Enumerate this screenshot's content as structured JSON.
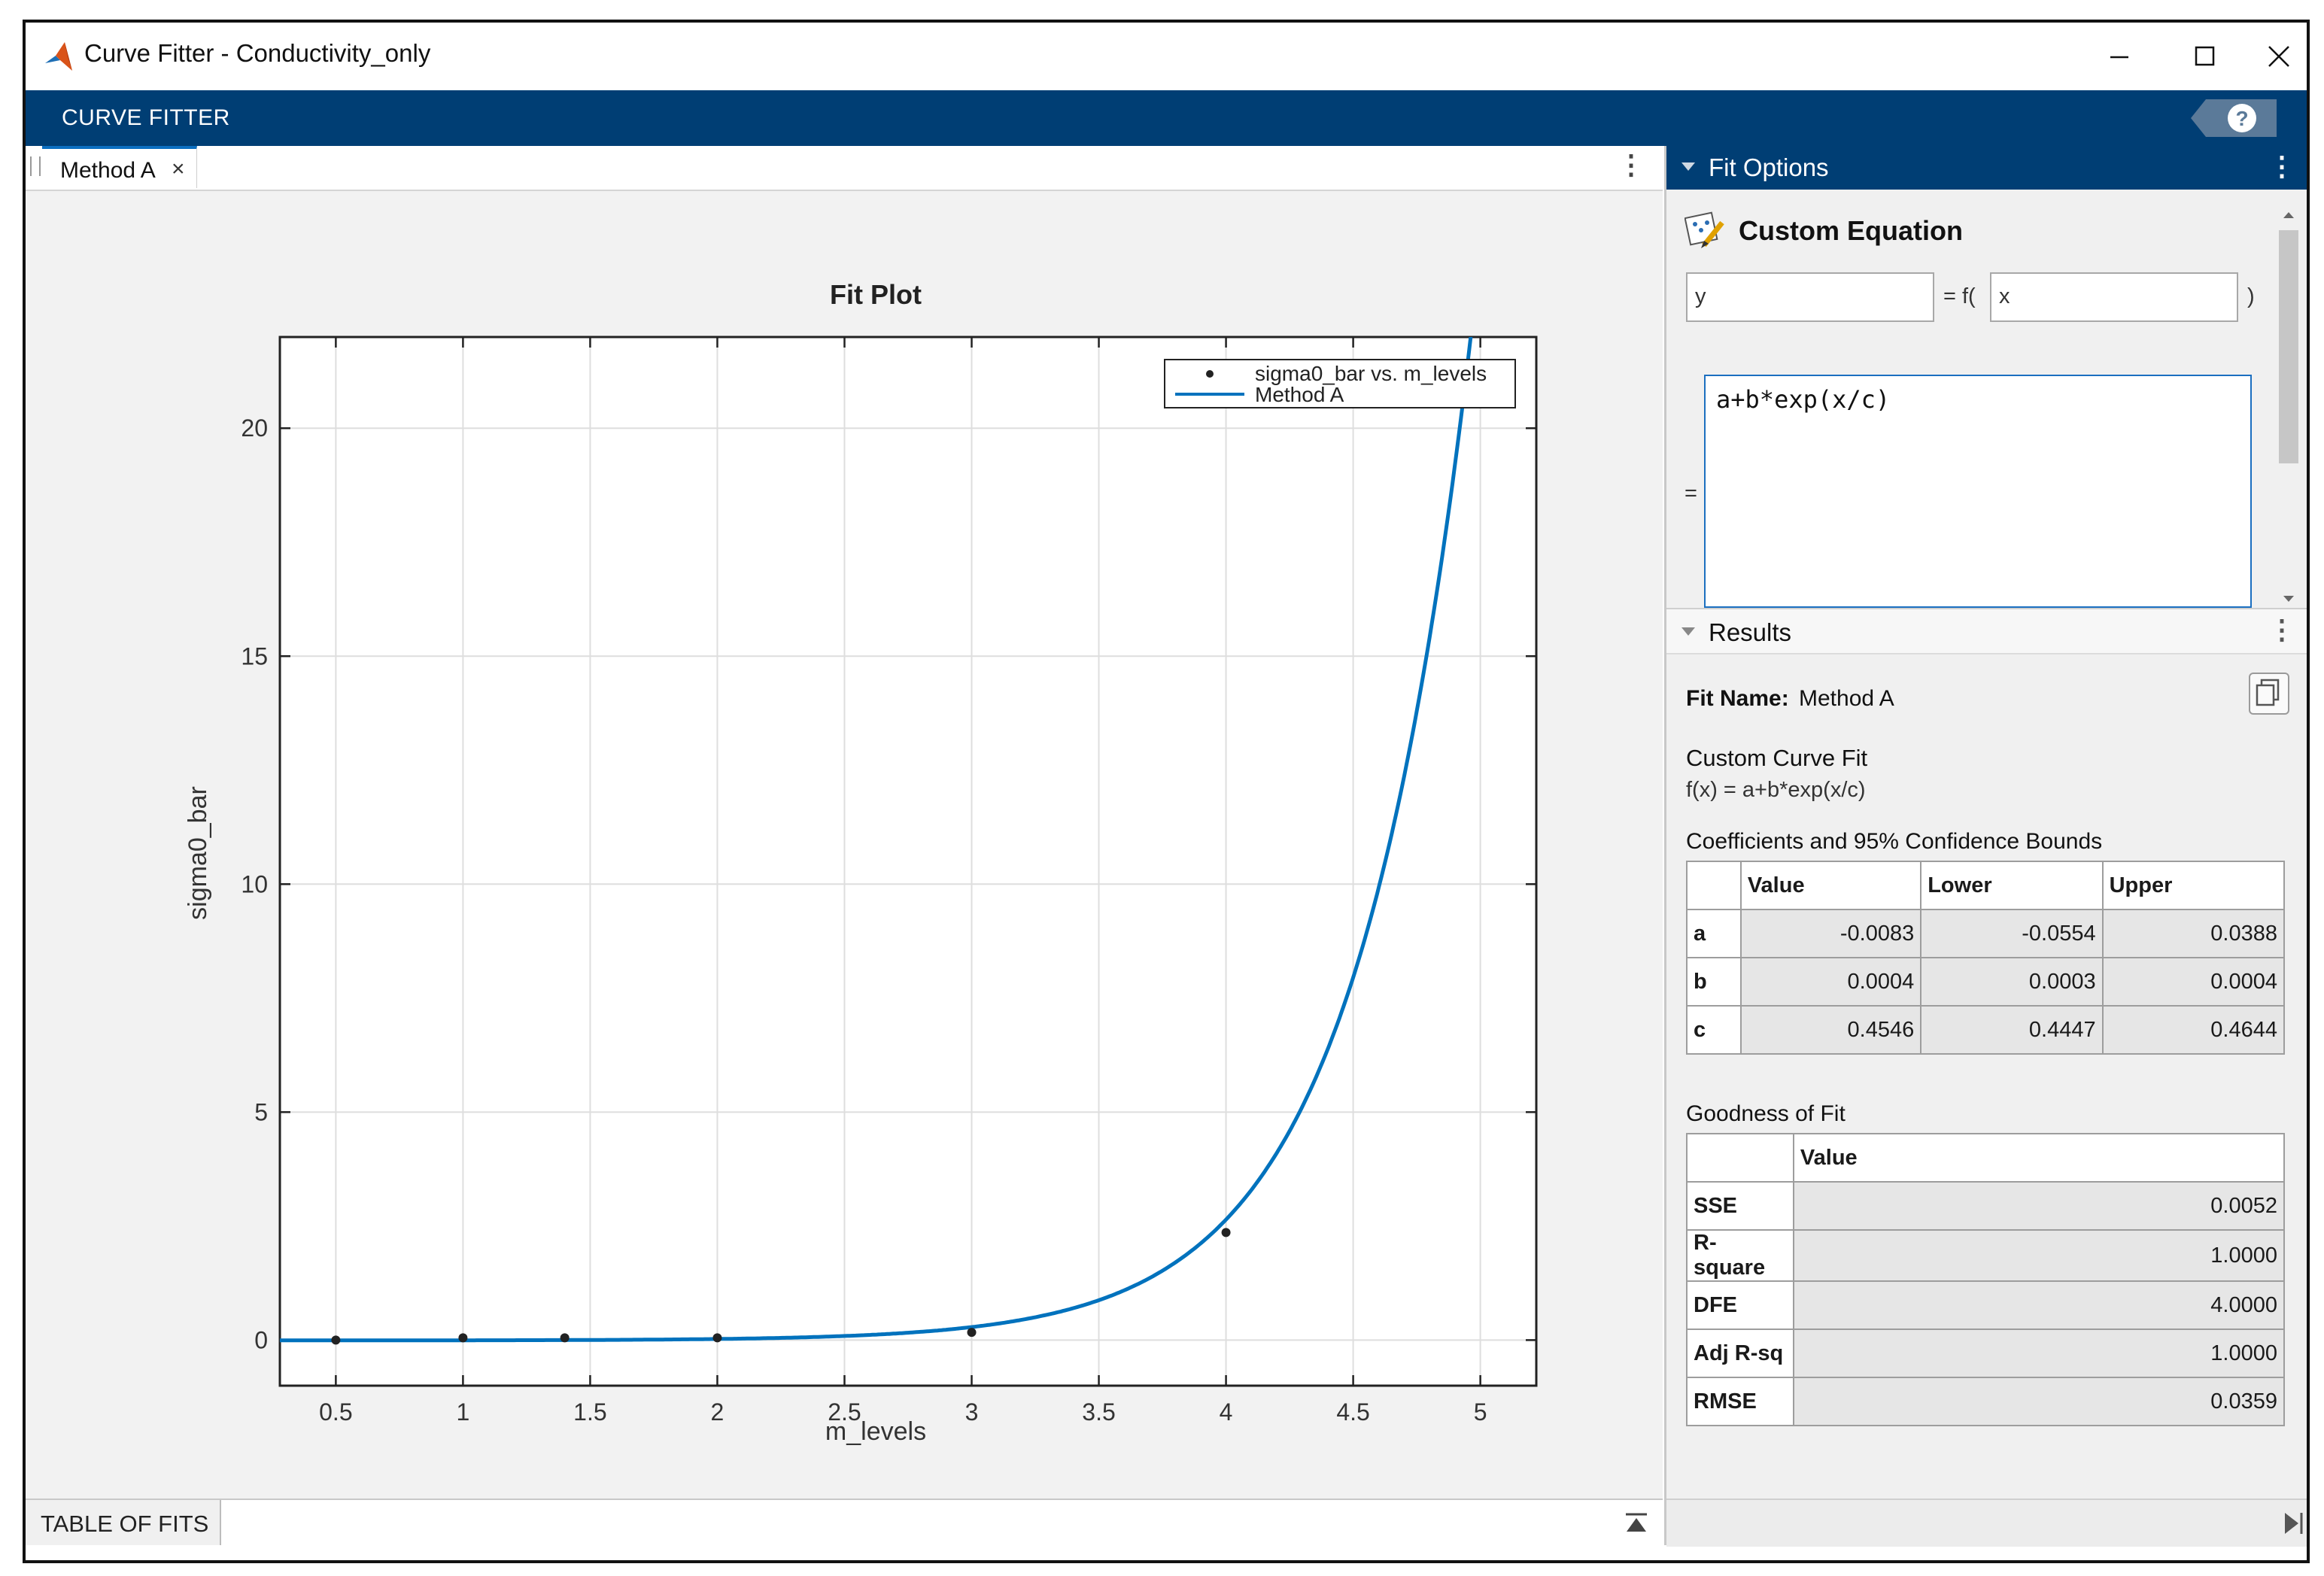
{
  "window": {
    "title": "Curve Fitter - Conductivity_only",
    "minimize": "–",
    "maximize": "☐",
    "close": "✕"
  },
  "toolstrip": {
    "label": "CURVE FITTER",
    "help": "?"
  },
  "document": {
    "tab_label": "Method A",
    "tab_close": "×",
    "menu": "⋮"
  },
  "chart_data": {
    "type": "scatter",
    "title": "Fit Plot",
    "xlabel": "m_levels",
    "ylabel": "sigma0_bar",
    "xlim": [
      0.28,
      5.22
    ],
    "ylim": [
      -1.0,
      22.0
    ],
    "xticks": [
      "0.5",
      "1",
      "1.5",
      "2",
      "2.5",
      "3",
      "3.5",
      "4",
      "4.5",
      "5"
    ],
    "yticks": [
      "0",
      "5",
      "10",
      "15",
      "20"
    ],
    "grid": true,
    "legend_position": "top-right",
    "series": [
      {
        "name": "sigma0_bar vs. m_levels",
        "kind": "points",
        "color": "#222222",
        "x": [
          0.5,
          1,
          1.4,
          2,
          3,
          4
        ],
        "y": [
          0.0,
          0.05,
          0.05,
          0.05,
          0.17,
          2.36
        ]
      },
      {
        "name": "Method A",
        "kind": "fit",
        "color": "#0072bd",
        "equation": {
          "a": -0.0083,
          "b": 0.0004,
          "c": 0.4546
        }
      }
    ]
  },
  "bottom": {
    "table_of_fits": "TABLE OF FITS"
  },
  "fit_options": {
    "header": "Fit Options",
    "menu": "⋮",
    "equation_type": "Custom Equation",
    "y_var": "y",
    "f_open": "= f(",
    "x_var": "x",
    "f_close": ")",
    "equals": "=",
    "equation": "a+b*exp(x/c)"
  },
  "results": {
    "header": "Results",
    "menu": "⋮",
    "fit_name_label": "Fit Name:",
    "fit_name": "Method A",
    "model_title": "Custom Curve Fit",
    "model_eq": "f(x) = a+b*exp(x/c)",
    "coef_title": "Coefficients and 95% Confidence Bounds",
    "coef_headers": [
      "Value",
      "Lower",
      "Upper"
    ],
    "coef_rows": [
      {
        "name": "a",
        "value": "-0.0083",
        "lower": "-0.0554",
        "upper": "0.0388"
      },
      {
        "name": "b",
        "value": "0.0004",
        "lower": "0.0003",
        "upper": "0.0004"
      },
      {
        "name": "c",
        "value": "0.4546",
        "lower": "0.4447",
        "upper": "0.4644"
      }
    ],
    "gof_title": "Goodness of Fit",
    "gof_header": "Value",
    "gof_rows": [
      {
        "name": "SSE",
        "value": "0.0052"
      },
      {
        "name": "R-square",
        "value": "1.0000"
      },
      {
        "name": "DFE",
        "value": "4.0000"
      },
      {
        "name": "Adj R-sq",
        "value": "1.0000"
      },
      {
        "name": "RMSE",
        "value": "0.0359"
      }
    ]
  }
}
